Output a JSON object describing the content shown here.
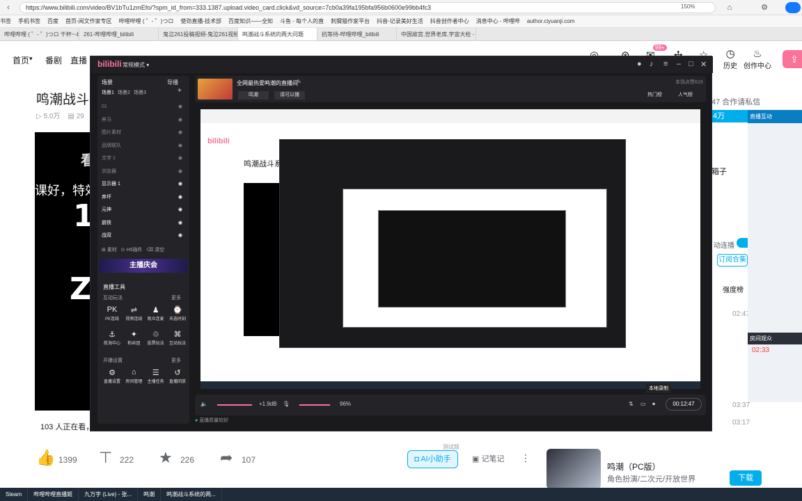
{
  "browser": {
    "url": "https://www.bilibili.com/video/BV1bTu1zmEfo/?spm_id_from=333.1387.upload.video_card.click&vd_source=7cb0a39fa195bfa956b0600e99bb4fc3",
    "zoom": "150%",
    "bookmarks": [
      "书签",
      "手机书签",
      "百度",
      "首页-阅文作家专区",
      "哔哩哔哩 ( ゜- ゜)つロ",
      "使劲直播-技术部",
      "百度知识——全知",
      "斗鱼 - 每个人的直",
      "刺猬猫作家平台",
      "抖音-记录美好生活",
      "抖音创作者中心",
      "消息中心 - 哔哩哔",
      "author.ciyuanji.com"
    ],
    "tabs": [
      "哔哩哔哩 ( ゜- ゜)つロ 干杯~-bili",
      "261-哔哩哔哩_bilibili",
      "鬼泣261投稿视频-鬼泣261视频",
      "鸣潮战斗系统的两大问题",
      "抗等待-哔哩哔哩_bilibili",
      "中国故宫,世界老库,宇宙大检 - 抖"
    ],
    "active_tab": 3
  },
  "nav": {
    "home": "首页",
    "drama": "番剧",
    "live": "直播",
    "history": "历史",
    "creator": "创作中心",
    "badge": "99+"
  },
  "video": {
    "title": "鸣潮战斗系",
    "views": "5.0万",
    "danmaku": "29",
    "banner_text": "看",
    "subtitle_line": "课好，特效",
    "big1": "1",
    "big2": "Z",
    "viewers": "103 人正在看，",
    "likes": "1399",
    "coins": "222",
    "favorites": "226",
    "shares": "107",
    "ai_assist": "AI小助手",
    "test_tag": "测试版",
    "notes": "记笔记",
    "contact": "47 合作请私信",
    "fans": "4万",
    "game_name": "鸣潮（PC版）",
    "game_sub": "角色扮演/二次元/开放世界",
    "download": "下载"
  },
  "side": {
    "live_interaction": "直播互动",
    "link_toggle": "动连播",
    "subscribe": "订阅合集",
    "intensity": "强度榜",
    "times": [
      "02:47",
      "03:37",
      "03:17"
    ],
    "room_viewers": "房间观众",
    "timer": "02:33",
    "dots": "..."
  },
  "live_app": {
    "logo": "bilibili",
    "mode": "常规模式",
    "scenes_header": "场景",
    "guide": "导播",
    "scene_tabs": [
      "场景1",
      "场景2",
      "场景3"
    ],
    "sources": [
      "01",
      "养马",
      "图片素材",
      "品牌联队",
      "文字 1",
      "浏览器",
      "显示器 1",
      "弃坏",
      "元神",
      "崩铁",
      "战双"
    ],
    "left_footer": [
      "素材",
      "H5插件",
      "清空"
    ],
    "banner": "主播庆会",
    "tools_header": "直播工具",
    "more": "更多",
    "interact_header": "互动玩法",
    "tools_row1": [
      "PK连线",
      "视频连线",
      "观众连麦",
      "天选时刻"
    ],
    "tools_row2": [
      "航海中心",
      "粉丝团",
      "投票玩法",
      "互动玩法"
    ],
    "settings_header": "开播设置",
    "tools_row3": [
      "直播设置",
      "房间管理",
      "主播任务",
      "直播回放"
    ],
    "room_title": "全网最热爱鸣潮的直播间",
    "room_tags": [
      "鸣潮",
      "请可以播"
    ],
    "room_meta": "本场点赞619",
    "hot_rank": "热门榜",
    "popularity": "人气榜",
    "gain": "+1.9dB",
    "volume": "96%",
    "local_record": "本地录制",
    "duration": "00:12:47",
    "status": "直播质量较好"
  },
  "taskbar": [
    "Steam",
    "哔哩哔哩直播姬",
    "九万字 (Live) - 张...",
    "鸣潮",
    "鸣潮战斗系统的两..."
  ]
}
